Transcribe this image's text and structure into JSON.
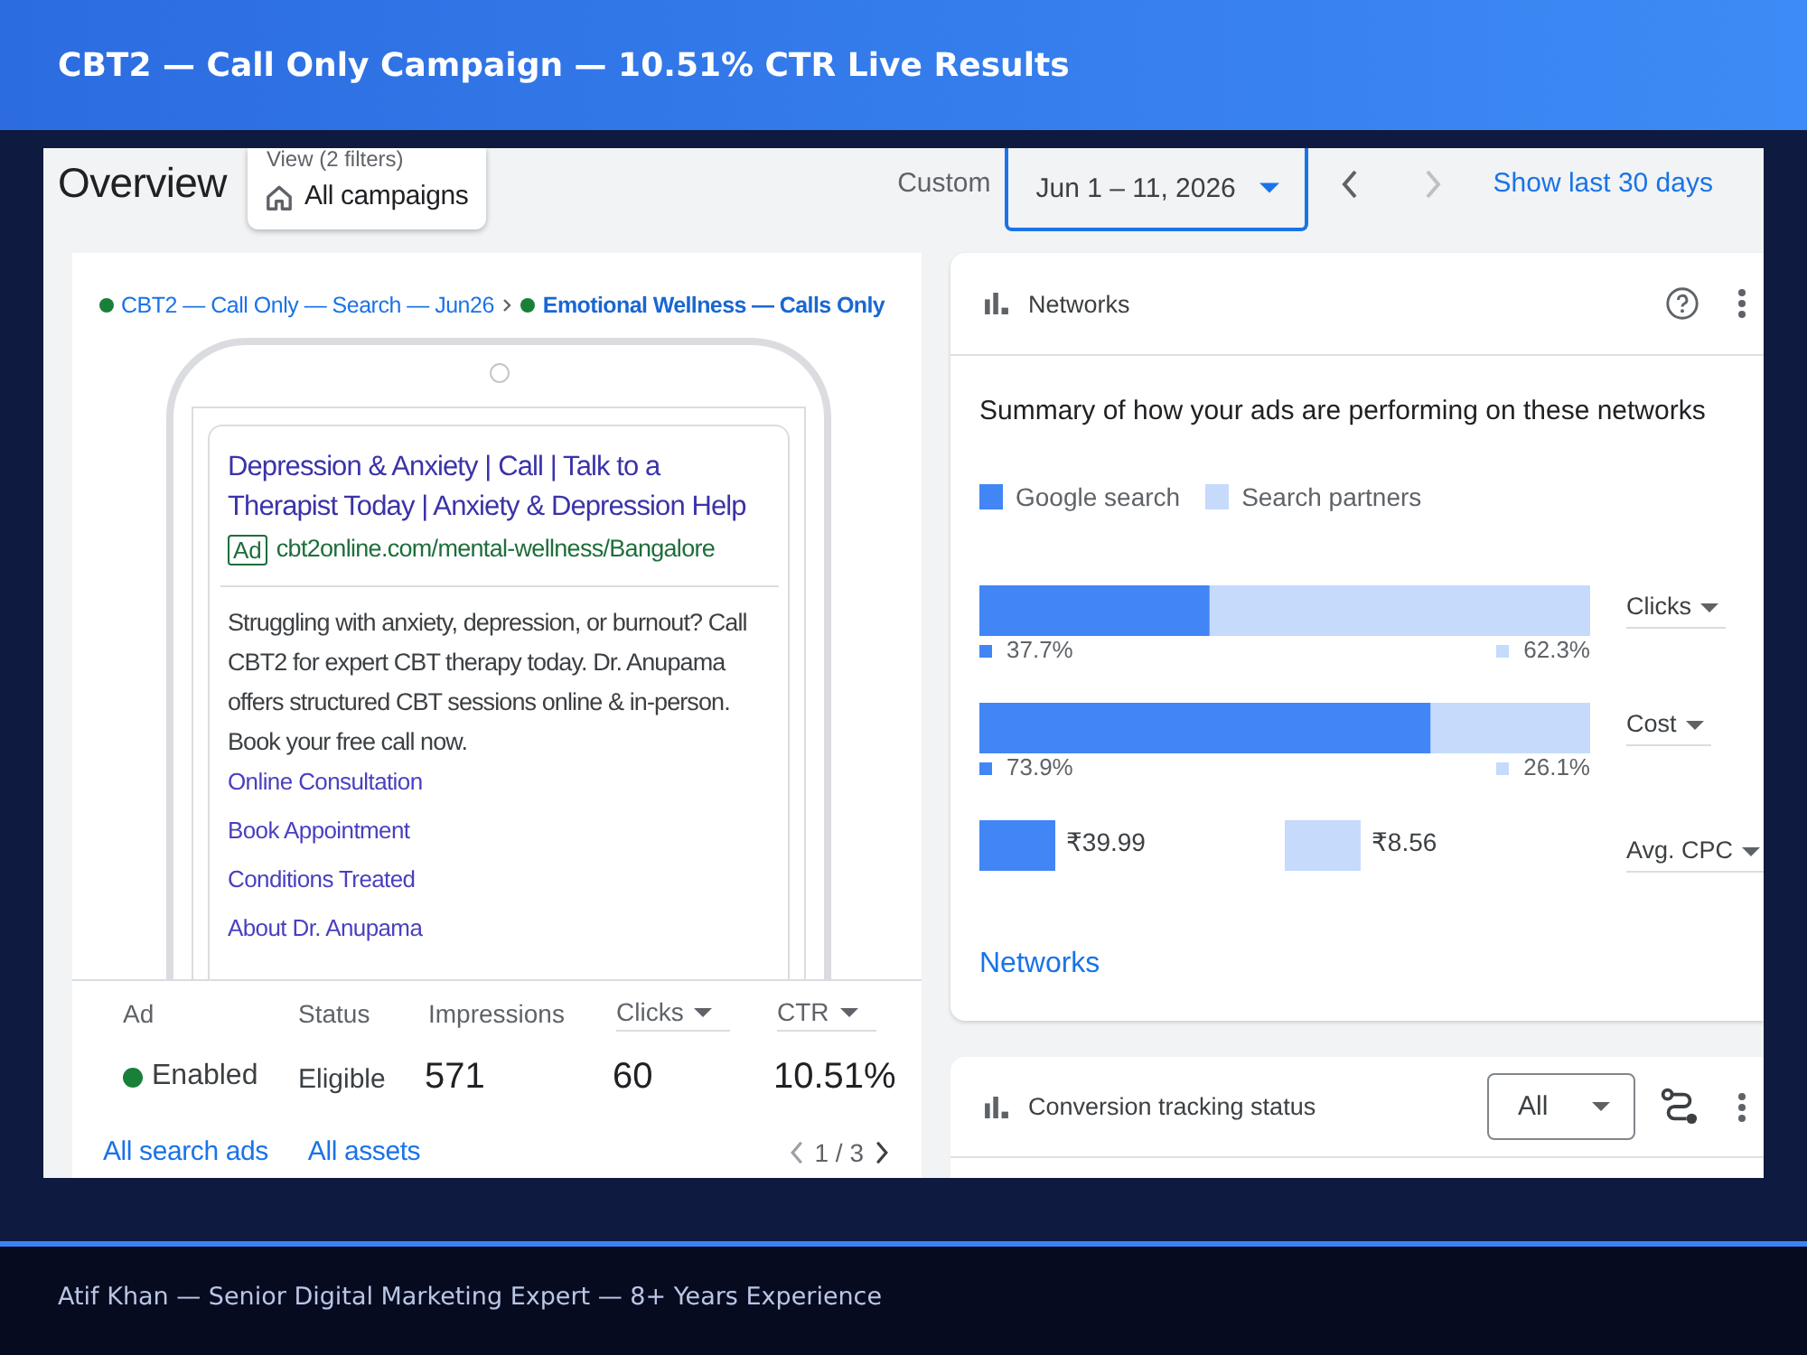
{
  "header": {
    "title": "CBT2 — Call Only Campaign — 10.51% CTR Live Results"
  },
  "toolbar": {
    "title": "Overview",
    "filter": {
      "caption": "View (2 filters)",
      "label": "All campaigns"
    },
    "date_range": {
      "label": "Custom",
      "value": "Jun 1 – 11, 2026"
    },
    "nav": [
      {
        "kind": "prev",
        "disabled": false
      },
      {
        "kind": "next",
        "disabled": true
      }
    ],
    "link": "Show last 30 days"
  },
  "ad_card": {
    "breadcrumb": [
      {
        "label": "CBT2 — Call Only — Search — Jun26",
        "enabled": true,
        "current": false
      },
      {
        "label": "Emotional Wellness — Calls Only",
        "enabled": true,
        "current": true
      }
    ],
    "ad": {
      "headline": "Depression & Anxiety | Call | Talk to a Therapist Today | Anxiety & Depression Help",
      "badge": "Ad",
      "url": "cbt2online.com/mental-wellness/Bangalore",
      "description": "Struggling with anxiety, depression, or burnout? Call CBT2 for expert CBT therapy today. Dr. Anupama offers structured CBT sessions online & in-person. Book your free call now.",
      "sitelinks": [
        "Online Consultation",
        "Book Appointment",
        "Conditions Treated",
        "About Dr. Anupama"
      ]
    },
    "stats": {
      "columns": [
        {
          "label": "Ad",
          "menu": false
        },
        {
          "label": "Status",
          "menu": false
        },
        {
          "label": "Impressions",
          "menu": false
        },
        {
          "label": "Clicks",
          "menu": true
        },
        {
          "label": "CTR",
          "menu": true
        }
      ],
      "cells": [
        {
          "kind": "status",
          "text": "Enabled",
          "enabled": true
        },
        {
          "kind": "text",
          "text": "Eligible"
        },
        {
          "kind": "metric",
          "text": "571"
        },
        {
          "kind": "metric",
          "text": "60"
        },
        {
          "kind": "metric",
          "text": "10.51%"
        }
      ]
    },
    "links": [
      "All search ads",
      "All assets"
    ],
    "pager": {
      "text": "1 / 3",
      "prev_disabled": true,
      "next_disabled": false
    }
  },
  "networks": {
    "title": "Networks",
    "summary": "Summary of how your ads are performing on these networks",
    "chart_data": {
      "type": "bar",
      "orientation": "horizontal",
      "stacked": true,
      "categories": [
        "Clicks",
        "Cost"
      ],
      "series": [
        {
          "name": "Google search",
          "color": "#4285f4",
          "values": [
            37.7,
            73.9
          ],
          "value_labels": [
            "37.7%",
            "73.9%"
          ]
        },
        {
          "name": "Search partners",
          "color": "#c6dafc",
          "values": [
            62.3,
            26.1
          ],
          "value_labels": [
            "62.3%",
            "26.1%"
          ]
        }
      ]
    },
    "avg_cpc": {
      "label": "Avg. CPC",
      "values": [
        "₹39.99",
        "₹8.56"
      ]
    },
    "link": "Networks"
  },
  "conversion": {
    "title": "Conversion tracking status",
    "select": "All"
  },
  "footer": {
    "text": "Atif Khan — Senior Digital Marketing Expert — 8+ Years Experience"
  }
}
